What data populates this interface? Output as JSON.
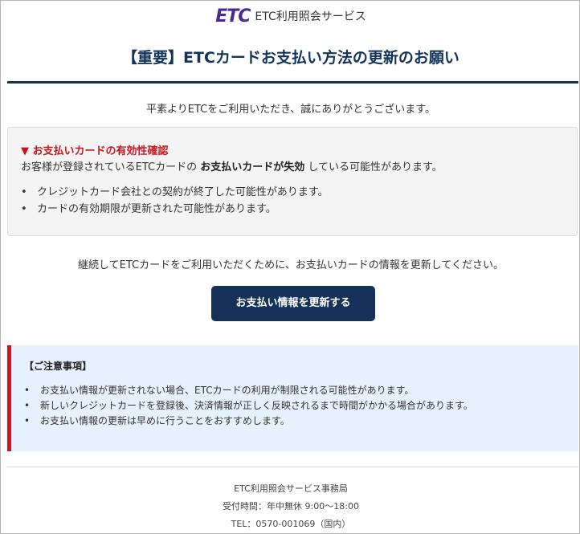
{
  "header": {
    "logo_mark": "ETC",
    "service_name": "ETC利用照会サービス",
    "brand_color": "#4a2a91"
  },
  "title": "【重要】ETCカードお支払い方法の更新のお願い",
  "greeting": "平素よりETCをご利用いただき、誠にありがとうございます。",
  "notice": {
    "heading": "▼ お支払いカードの有効性確認",
    "body_before": "お客様が登録されているETCカードの ",
    "body_bold": "お支払いカードが失効",
    "body_after": " している可能性があります。",
    "items": [
      "クレジットカード会社との契約が終了した可能性があります。",
      "カードの有効期限が更新された可能性があります。"
    ]
  },
  "continue_text": "継続してETCカードをご利用いただくために、お支払いカードの情報を更新してください。",
  "button": {
    "label": "お支払い情報を更新する",
    "color": "#143257"
  },
  "caution": {
    "heading": "【ご注意事項】",
    "items": [
      "お支払い情報が更新されない場合、ETCカードの利用が制限される可能性があります。",
      "新しいクレジットカードを登録後、決済情報が正しく反映されるまで時間がかかる場合があります。",
      "お支払い情報の更新は早めに行うことをおすすめします。"
    ],
    "accent_color": "#c8161e"
  },
  "footer": {
    "office": "ETC利用照会サービス事務局",
    "hours": "受付時間：年中無休 9:00〜18:00",
    "tel": "TEL：0570-001069（国内）"
  }
}
